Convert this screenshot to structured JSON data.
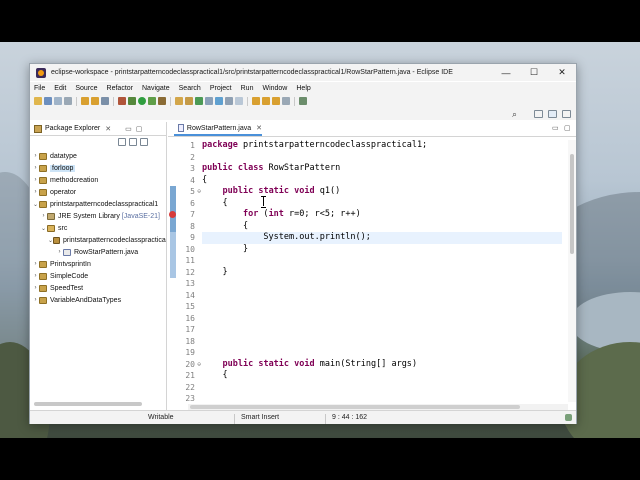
{
  "window": {
    "title": "eclipse-workspace - printstarpatterncodeclasspractical1/src/printstarpatterncodeclasspractical1/RowStarPattern.java - Eclipse IDE",
    "controls": {
      "minimize": "—",
      "maximize": "☐",
      "close": "✕"
    }
  },
  "menu": [
    "File",
    "Edit",
    "Source",
    "Refactor",
    "Navigate",
    "Search",
    "Project",
    "Run",
    "Window",
    "Help"
  ],
  "package_explorer": {
    "tab_label": "Package Explorer",
    "close_glyph": "✕",
    "items": [
      {
        "label": "datatype",
        "extra": "",
        "twisty": "›",
        "icon": "project"
      },
      {
        "label": "forloop",
        "extra": "",
        "twisty": "›",
        "icon": "project"
      },
      {
        "label": "methodcreation",
        "extra": "",
        "twisty": "›",
        "icon": "project"
      },
      {
        "label": "operator",
        "extra": "",
        "twisty": "›",
        "icon": "project"
      },
      {
        "label": "printstarpatterncodeclasspractical1",
        "extra": "",
        "twisty": "⌄",
        "icon": "project"
      },
      {
        "label": "JRE System Library",
        "extra": "[JavaSE-21]",
        "twisty": "›",
        "icon": "library"
      },
      {
        "label": "src",
        "extra": "",
        "twisty": "⌄",
        "icon": "source-folder"
      },
      {
        "label": "printstarpatterncodeclasspractical1",
        "extra": "",
        "twisty": "⌄",
        "icon": "package"
      },
      {
        "label": "RowStarPattern.java",
        "extra": "",
        "twisty": "›",
        "icon": "java-file"
      },
      {
        "label": "PrintvsprintIn",
        "extra": "",
        "twisty": "›",
        "icon": "project"
      },
      {
        "label": "SimpleCode",
        "extra": "",
        "twisty": "›",
        "icon": "project"
      },
      {
        "label": "SpeedTest",
        "extra": "",
        "twisty": "›",
        "icon": "project"
      },
      {
        "label": "VariableAndDataTypes",
        "extra": "",
        "twisty": "›",
        "icon": "project"
      }
    ],
    "selected_index": 1
  },
  "editor": {
    "tab_label": "RowStarPattern.java",
    "close_glyph": "✕",
    "line_numbers": [
      "1",
      "2",
      "3",
      "4",
      "5",
      "6",
      "7",
      "8",
      "9",
      "10",
      "11",
      "12",
      "13",
      "14",
      "15",
      "16",
      "17",
      "18",
      "19",
      "20",
      "21",
      "22",
      "23"
    ],
    "lines": [
      "package printstarpatterncodeclasspractical1;",
      "",
      "public class RowStarPattern",
      "{",
      "    public static void q1()",
      "    {",
      "        for (int r=0; r<5; r++)",
      "        {",
      "            System.out.println();",
      "        }",
      "",
      "    }",
      "",
      "",
      "",
      "",
      "",
      "",
      "",
      "    public static void main(String[] args)",
      "    {",
      "",
      ""
    ],
    "current_line": 9,
    "error_line": 7
  },
  "status": {
    "mode": "Writable",
    "insert_mode": "Smart Insert",
    "position": "9 : 44 : 162"
  },
  "icons": {
    "app": "eclipse-icon",
    "explorer": "package-explorer-icon",
    "java_file": "java-file-icon"
  },
  "colors": {
    "keyword": "#7f0055",
    "current_line": "#e8f2fe",
    "selection": "#cde4f7",
    "error": "#d83a3a"
  }
}
